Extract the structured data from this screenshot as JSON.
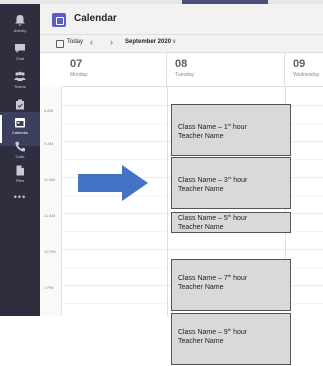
{
  "app": {
    "title": "Calendar"
  },
  "sidebar": {
    "items": [
      {
        "label": "Activity",
        "icon": "bell-icon"
      },
      {
        "label": "Chat",
        "icon": "chat-icon"
      },
      {
        "label": "Teams",
        "icon": "teams-icon"
      },
      {
        "label": "Assignments",
        "icon": "assignments-icon"
      },
      {
        "label": "Calendar",
        "icon": "calendar-icon",
        "active": true
      },
      {
        "label": "Calls",
        "icon": "phone-icon"
      },
      {
        "label": "Files",
        "icon": "file-icon"
      }
    ],
    "more": "•••"
  },
  "toolbar": {
    "today_label": "Today",
    "prev": "‹",
    "next": "›",
    "month_label": "September 2020",
    "month_chevron": "∨"
  },
  "days": [
    {
      "num": "07",
      "name": "Monday"
    },
    {
      "num": "08",
      "name": "Tuesday"
    },
    {
      "num": "09",
      "name": "Wednesday"
    }
  ],
  "times": [
    "8 AM",
    "9 AM",
    "10 AM",
    "11 AM",
    "12 PM",
    "1 PM"
  ],
  "events": [
    {
      "class_prefix": "Class Name – 1",
      "ordinal": "st",
      "class_suffix": " hour",
      "teacher": "Teacher  Name"
    },
    {
      "class_prefix": "Class Name – 3",
      "ordinal": "rd",
      "class_suffix": " hour",
      "teacher": "Teacher  Name"
    },
    {
      "class_prefix": "Class Name – 5",
      "ordinal": "th",
      "class_suffix": " hour",
      "teacher": "Teacher  Name"
    },
    {
      "class_prefix": "Class Name – 7",
      "ordinal": "th",
      "class_suffix": " hour",
      "teacher": "Teacher  Name"
    },
    {
      "class_prefix": "Class Name – 9",
      "ordinal": "th",
      "class_suffix": " hour",
      "teacher": "Teacher  Name"
    }
  ],
  "colors": {
    "sidebar": "#2e2e3f",
    "accent": "#5b5fc7",
    "arrow": "#4472c4",
    "event_fill": "#d9d9d9"
  }
}
